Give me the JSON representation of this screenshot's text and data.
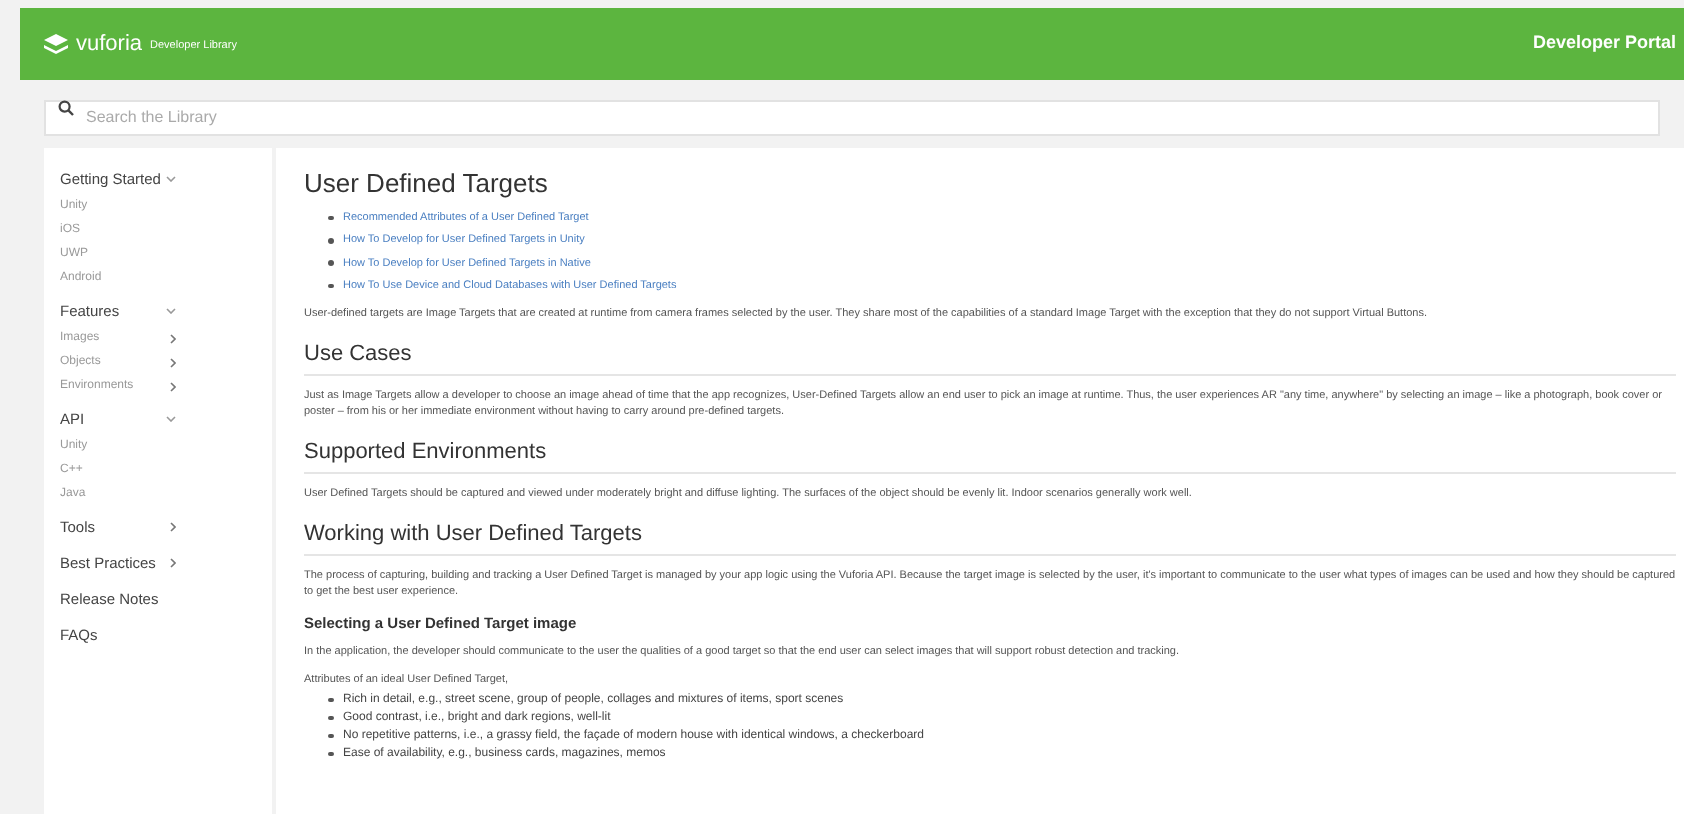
{
  "header": {
    "logo": "vuforia",
    "subtitle": "Developer Library",
    "portal_link": "Developer Portal"
  },
  "search": {
    "placeholder": "Search the Library"
  },
  "sidebar": {
    "items": [
      {
        "kind": "group",
        "label": "Getting Started",
        "expanded": true,
        "children": [
          {
            "kind": "link",
            "label": "Unity"
          },
          {
            "kind": "link",
            "label": "iOS"
          },
          {
            "kind": "link",
            "label": "UWP"
          },
          {
            "kind": "link",
            "label": "Android"
          }
        ]
      },
      {
        "kind": "group",
        "label": "Features",
        "expanded": true,
        "children": [
          {
            "kind": "group",
            "label": "Images",
            "expanded": false
          },
          {
            "kind": "group",
            "label": "Objects",
            "expanded": false
          },
          {
            "kind": "group",
            "label": "Environments",
            "expanded": false
          }
        ]
      },
      {
        "kind": "group",
        "label": "API",
        "expanded": true,
        "children": [
          {
            "kind": "link",
            "label": "Unity"
          },
          {
            "kind": "link",
            "label": "C++"
          },
          {
            "kind": "link",
            "label": "Java"
          }
        ]
      },
      {
        "kind": "group",
        "label": "Tools",
        "expanded": false
      },
      {
        "kind": "group",
        "label": "Best Practices",
        "expanded": false
      },
      {
        "kind": "link",
        "label": "Release Notes"
      },
      {
        "kind": "link",
        "label": "FAQs"
      }
    ]
  },
  "article": {
    "title": "User Defined Targets",
    "links": [
      "Recommended Attributes of a User Defined Target",
      "How To Develop for User Defined Targets in Unity",
      "How To Develop for User Defined Targets in Native",
      "How To Use Device and Cloud Databases with User Defined Targets"
    ],
    "blocks": [
      {
        "kind": "paragraph",
        "text": "User-defined targets are Image Targets that are created at runtime from camera frames selected by the user. They share most of the capabilities of a standard Image Target with the exception that they do not support Virtual Buttons."
      },
      {
        "kind": "heading",
        "text": "Use Cases"
      },
      {
        "kind": "paragraph",
        "text": "Just as Image Targets allow a developer to choose an image ahead of time that the app recognizes, User-Defined Targets allow an end user to pick an image at runtime. Thus, the user experiences AR \"any time, anywhere\" by selecting an image – like a photograph, book cover or poster – from his or her immediate environment without having to carry around pre-defined targets."
      },
      {
        "kind": "heading",
        "text": "Supported Environments"
      },
      {
        "kind": "paragraph",
        "text": "User Defined Targets should be captured and viewed under moderately bright and diffuse lighting.  The surfaces of the object should be evenly lit. Indoor scenarios generally work well."
      },
      {
        "kind": "heading",
        "text": "Working with User Defined Targets"
      },
      {
        "kind": "paragraph",
        "text": "The process of capturing, building and tracking a User Defined Target is managed by your app logic using the Vuforia API. Because the target image is selected by the user, it's important to communicate to the user what types of images can be used and how they should be captured to get the best user experience."
      },
      {
        "kind": "subheading",
        "text": "Selecting a User Defined Target image"
      },
      {
        "kind": "paragraph",
        "text": "In the application, the developer should communicate to the user the qualities of a good target so that the end user can select images that will support robust detection and tracking."
      },
      {
        "kind": "paragraph",
        "text": "Attributes of an ideal User Defined Target,"
      },
      {
        "kind": "bullets",
        "items": [
          "Rich in detail, e.g., street scene, group of people, collages and mixtures of items, sport scenes",
          "Good contrast, i.e., bright and dark regions, well-lit",
          "No repetitive patterns, i.e., a grassy field, the façade of modern house with identical windows, a checkerboard",
          "Ease of availability, e.g., business cards, magazines, memos"
        ]
      }
    ]
  }
}
